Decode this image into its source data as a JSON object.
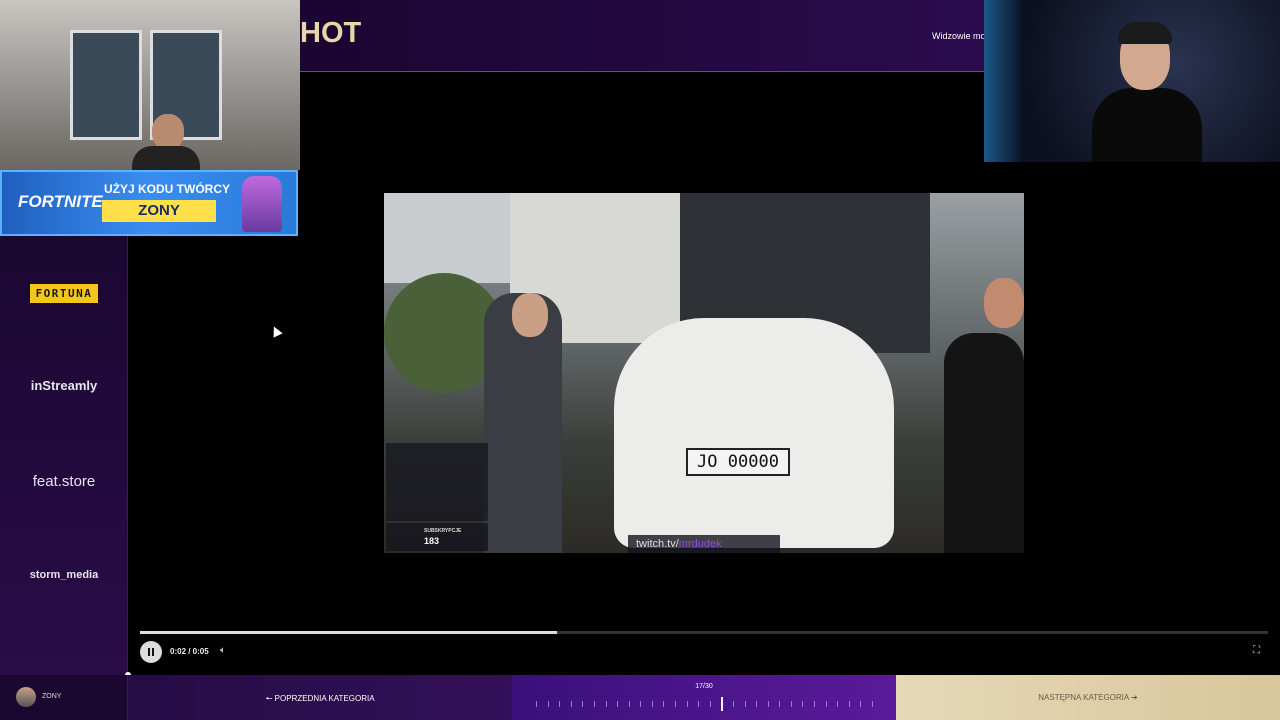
{
  "header": {
    "title": "HOT",
    "viewers_text": "Widzowie mog"
  },
  "fortnite": {
    "logo": "FORTNITE",
    "code_title": "UŻYJ KODU TWÓRCY",
    "code": "ZONY"
  },
  "sponsors": {
    "fortuna": "FORTUNA",
    "instreamly": "inStreamly",
    "featstore": "feat.store",
    "storm": "storm_media"
  },
  "video": {
    "plate": "JO 00000",
    "subs_label": "SUBSKRYPCJE",
    "subs_count": "183",
    "twitch_prefix": "twitch.tv/",
    "twitch_channel": "mrdudek"
  },
  "player": {
    "time": "0:02 / 0:05",
    "progress": 0.37
  },
  "bottom": {
    "user_name": "ZONY",
    "prev_label": "POPRZEDNIA KATEGORIA",
    "counter": "17/30",
    "current": 17,
    "total": 30,
    "next_label": "NASTĘPNA KATEGORIA"
  }
}
